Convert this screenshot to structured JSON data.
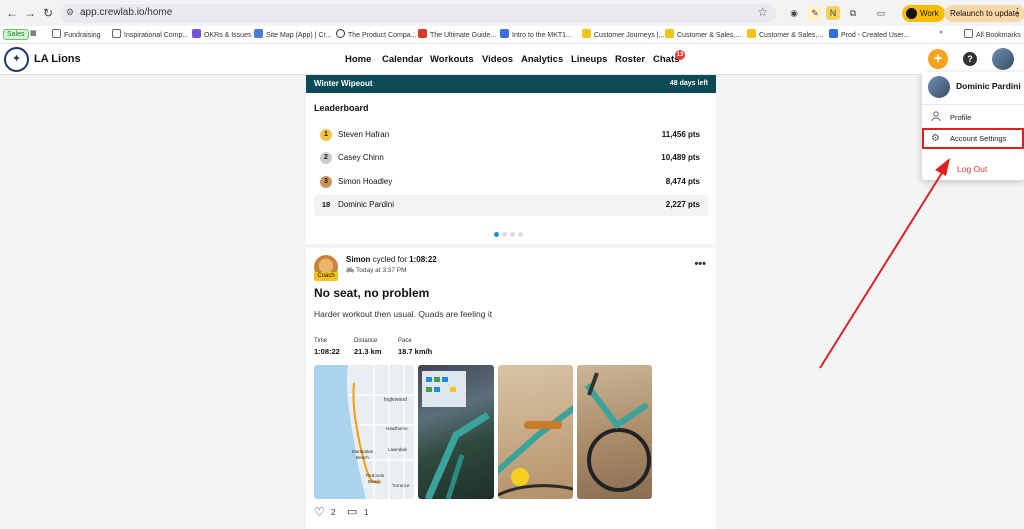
{
  "browser": {
    "url": "app.crewlab.io/home",
    "work_label": "Work",
    "relaunch_label": "Relaunch to update",
    "bookmarks": [
      {
        "label": "Sales"
      },
      {
        "label": "Fundraising"
      },
      {
        "label": "Inspirational Comp..."
      },
      {
        "label": "OKRs & Issues"
      },
      {
        "label": "Site Map (App) | Cr..."
      },
      {
        "label": "The Product Compa..."
      },
      {
        "label": "The Ultimate Guide..."
      },
      {
        "label": "Intro to the MKT1..."
      },
      {
        "label": "Customer Journeys |..."
      },
      {
        "label": "Customer & Sales,..."
      },
      {
        "label": "Customer & Sales,..."
      },
      {
        "label": "Prod - Created User..."
      },
      {
        "label": "All Bookmarks"
      }
    ],
    "bookmarks_overflow": "»"
  },
  "header": {
    "team_name": "LA Lions",
    "nav": [
      "Home",
      "Calendar",
      "Workouts",
      "Videos",
      "Analytics",
      "Lineups",
      "Roster",
      "Chats"
    ],
    "chat_badge": "13",
    "add_label": "+",
    "help_label": "?"
  },
  "challenge": {
    "title": "Winter Wipeout",
    "days_left": "48 days left",
    "leaderboard_title": "Leaderboard",
    "rows": [
      {
        "rank": "1",
        "name": "Steven Hafran",
        "points": "11,456 pts",
        "color": "#f5c242"
      },
      {
        "rank": "2",
        "name": "Casey Chinn",
        "points": "10,489 pts",
        "color": "#c9cdd2"
      },
      {
        "rank": "3",
        "name": "Simon Hoadley",
        "points": "8,474 pts",
        "color": "#c8955d"
      },
      {
        "rank": "18",
        "name": "Dominic Pardini",
        "points": "2,227 pts",
        "color": ""
      }
    ]
  },
  "activity": {
    "user": "Simon",
    "verb": "cycled for",
    "duration": "1:08:22",
    "time": "Today at 3:37 PM",
    "coach_badge": "Coach",
    "title": "No seat, no problem",
    "description": "Harder workout then usual. Quads are feeling it",
    "stats": [
      {
        "label": "Time",
        "value": "1:08:22"
      },
      {
        "label": "Distance",
        "value": "21.3 km"
      },
      {
        "label": "Pace",
        "value": "18.7 km/h"
      }
    ],
    "map_labels": [
      "Inglewood",
      "Hawthorne",
      "Manhattan Beach",
      "Lawndale",
      "Redondo Beach",
      "Torrance"
    ],
    "likes": "2",
    "comments": "1"
  },
  "user_menu": {
    "name": "Dominic Pardini",
    "items": [
      "Profile",
      "Account Settings",
      "Log Out"
    ]
  },
  "colors": {
    "challenge_bar": "#0c4a55",
    "accent_orange": "#f7a21b",
    "annotation_red": "#e02020"
  }
}
